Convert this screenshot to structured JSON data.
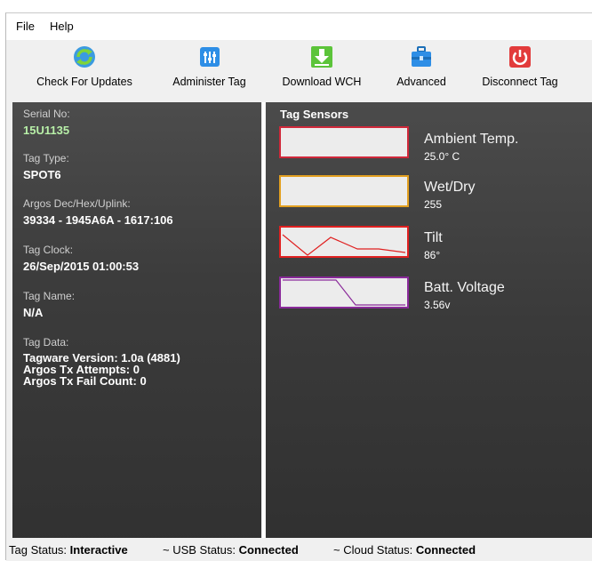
{
  "menu": {
    "file": "File",
    "help": "Help"
  },
  "toolbar": {
    "check_updates": {
      "label": "Check For Updates",
      "icon": "refresh-update-icon"
    },
    "administer_tag": {
      "label": "Administer Tag",
      "icon": "sliders-icon"
    },
    "download_wch": {
      "label": "Download WCH",
      "icon": "download-arrow-icon"
    },
    "advanced": {
      "label": "Advanced",
      "icon": "toolbox-icon"
    },
    "disconnect_tag": {
      "label": "Disconnect Tag",
      "icon": "power-icon"
    }
  },
  "tag_info": {
    "serial_label": "Serial No:",
    "serial_value": "15U1135",
    "type_label": "Tag Type:",
    "type_value": "SPOT6",
    "argos_label": "Argos Dec/Hex/Uplink:",
    "argos_value": "39334 - 1945A6A - 1617:106",
    "clock_label": "Tag Clock:",
    "clock_value": "26/Sep/2015 01:00:53",
    "name_label": "Tag Name:",
    "name_value": "N/A",
    "data_label": "Tag Data:",
    "data_lines": [
      "Tagware Version: 1.0a (4881)",
      "Argos Tx Attempts: 0",
      "Argos Tx Fail Count: 0"
    ]
  },
  "sensors": {
    "title": "Tag Sensors",
    "items": [
      {
        "name": "Ambient Temp.",
        "value": "25.0° C",
        "color": "#d0283a"
      },
      {
        "name": "Wet/Dry",
        "value": "255",
        "color": "#e3a020"
      },
      {
        "name": "Tilt",
        "value": "86°",
        "color": "#e02020"
      },
      {
        "name": "Batt. Voltage",
        "value": "3.56v",
        "color": "#8a2a9a"
      }
    ]
  },
  "status": {
    "tag_label": "Tag Status:",
    "tag_value": "Interactive",
    "usb_label": "~ USB Status:",
    "usb_value": "Connected",
    "cloud_label": "~ Cloud Status:",
    "cloud_value": "Connected"
  }
}
